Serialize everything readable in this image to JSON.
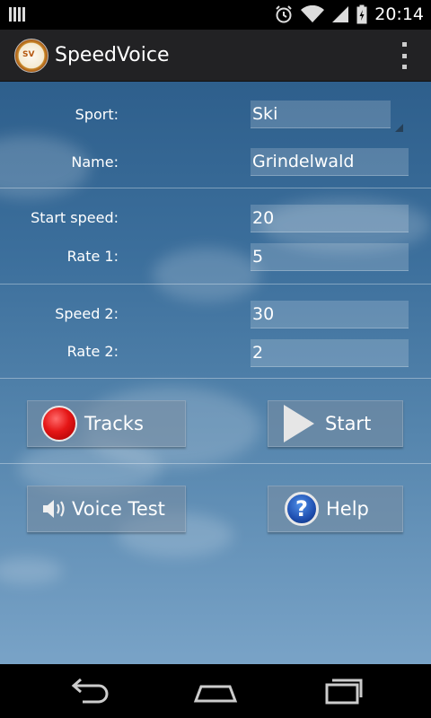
{
  "status_bar": {
    "time": "20:14"
  },
  "app": {
    "title": "SpeedVoice",
    "logo_text": "SV"
  },
  "form": {
    "sport_label": "Sport:",
    "sport_value": "Ski",
    "name_label": "Name:",
    "name_value": "Grindelwald",
    "start_speed_label": "Start speed:",
    "start_speed_value": "20",
    "rate1_label": "Rate 1:",
    "rate1_value": "5",
    "speed2_label": "Speed 2:",
    "speed2_value": "30",
    "rate2_label": "Rate 2:",
    "rate2_value": "2"
  },
  "buttons": {
    "tracks": "Tracks",
    "start": "Start",
    "voice_test": "Voice Test",
    "help": "Help",
    "help_glyph": "?"
  },
  "icons": {
    "tracks": "record-icon",
    "start": "play-icon",
    "voice_test": "speaker-icon",
    "help": "help-icon"
  },
  "colors": {
    "action_bar": "#222224",
    "record": "#e51616",
    "help": "#1f4fb0"
  }
}
